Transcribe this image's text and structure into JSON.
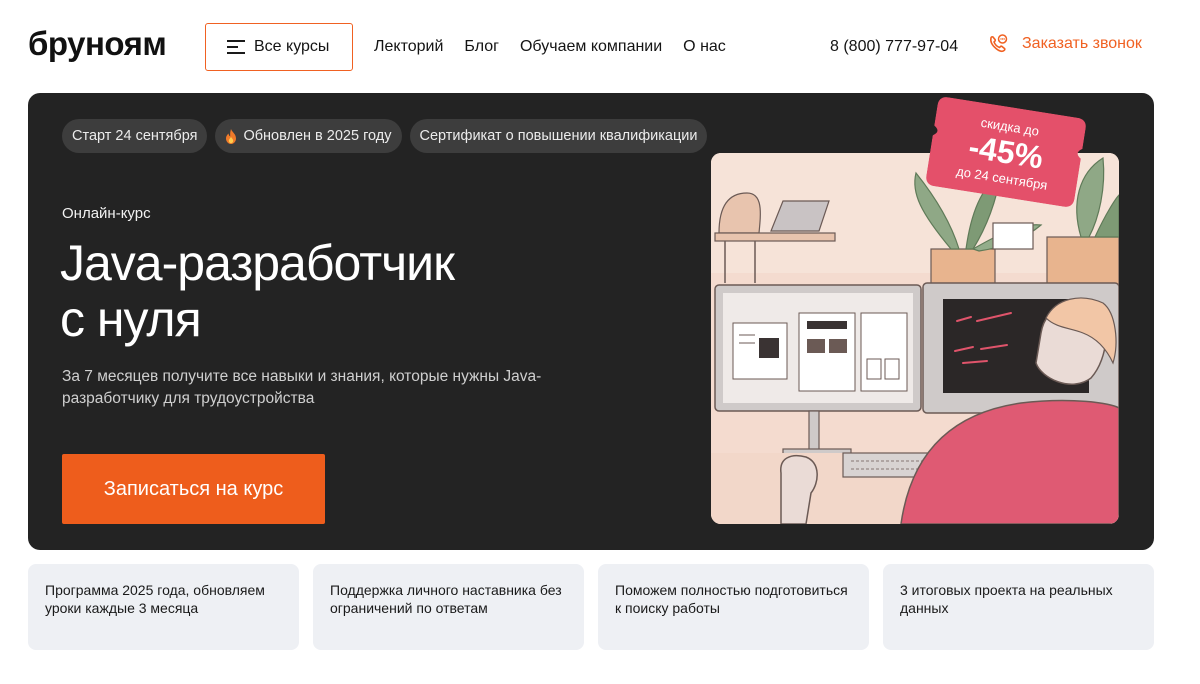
{
  "header": {
    "logo": "бруноям",
    "all_courses": "Все курсы",
    "nav": [
      "Лекторий",
      "Блог",
      "Обучаем компании",
      "О нас"
    ],
    "phone": "8 (800) 777-97-04",
    "callback": "Заказать звонок"
  },
  "hero": {
    "tags": [
      "Старт 24 сентября",
      "Обновлен в 2025 году",
      "Сертификат о повышении квалификации"
    ],
    "eyebrow": "Онлайн-курс",
    "title_line1": "Java-разработчик",
    "title_line2": "с нуля",
    "description": "За 7 месяцев получите все навыки и знания, которые нужны Java-разработчику для трудоустройства",
    "cta": "Записаться на курс",
    "discount": {
      "top": "скидка до",
      "value": "-45%",
      "bottom": "до 24 сентября"
    }
  },
  "features": [
    "Программа 2025 года, обновляем уроки каждые 3 месяца",
    "Поддержка личного наставника без ограничений по ответам",
    "Поможем полностью подготовиться к поиску работы",
    "3 итоговых проекта на реальных данных"
  ],
  "colors": {
    "accent": "#ee5d1c",
    "hero_bg": "#232323",
    "discount_bg": "#e4506a"
  }
}
